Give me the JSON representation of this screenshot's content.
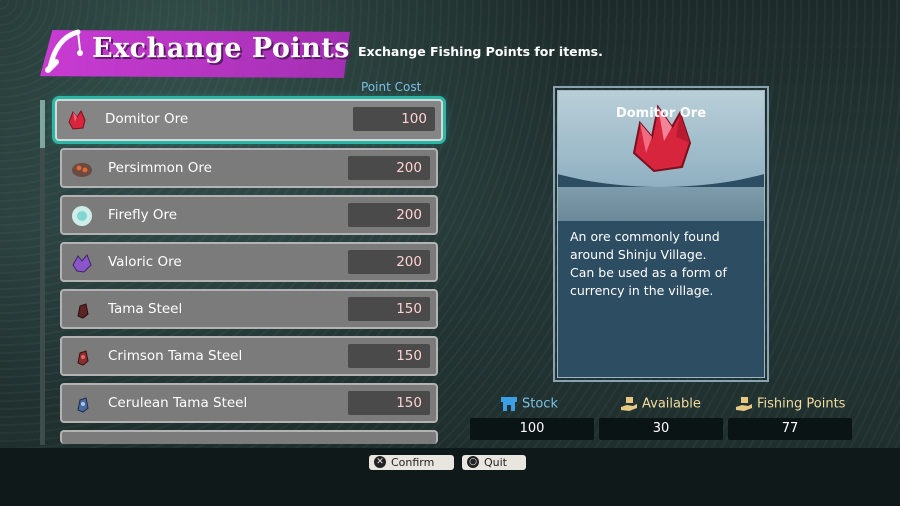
{
  "header": {
    "title": "Exchange Points",
    "subtitle": "Exchange Fishing Points for items.",
    "icon": "fishing-rod-icon"
  },
  "list": {
    "cost_header": "Point Cost",
    "items": [
      {
        "name": "Domitor Ore",
        "cost": "100",
        "selected": true,
        "icon": "red-ore-icon",
        "color": "#d8253e"
      },
      {
        "name": "Persimmon Ore",
        "cost": "200",
        "icon": "orange-ore-icon",
        "color": "#b35633"
      },
      {
        "name": "Firefly Ore",
        "cost": "200",
        "icon": "cyan-ore-icon",
        "color": "#a9e3e0"
      },
      {
        "name": "Valoric Ore",
        "cost": "200",
        "icon": "purple-ore-icon",
        "color": "#8a55c9"
      },
      {
        "name": "Tama Steel",
        "cost": "150",
        "icon": "dark-red-stone-icon",
        "color": "#7b2a2a"
      },
      {
        "name": "Crimson Tama Steel",
        "cost": "150",
        "icon": "crimson-stone-icon",
        "color": "#b03838"
      },
      {
        "name": "Cerulean Tama Steel",
        "cost": "150",
        "icon": "blue-stone-icon",
        "color": "#5b7fbd"
      }
    ]
  },
  "detail": {
    "name": "Domitor Ore",
    "description": [
      "An ore commonly found",
      "around Shinju Village.",
      "Can be used as a form of",
      "currency in the village."
    ]
  },
  "stats": {
    "stock": {
      "label": "Stock",
      "value": "100",
      "icon": "shop-icon"
    },
    "available": {
      "label": "Available",
      "value": "30",
      "icon": "hand-box-icon"
    },
    "fishing_points": {
      "label": "Fishing Points",
      "value": "77",
      "icon": "hand-box-icon"
    }
  },
  "footer": {
    "confirm_label": "Confirm",
    "quit_label": "Quit",
    "confirm_glyph": "✕",
    "quit_glyph": "○"
  },
  "colors": {
    "accent_teal": "#2ab7a6",
    "title_magenta": "#c93bd3",
    "cost_text": "#ffd2d2",
    "stat_label": "#f2dca0"
  }
}
